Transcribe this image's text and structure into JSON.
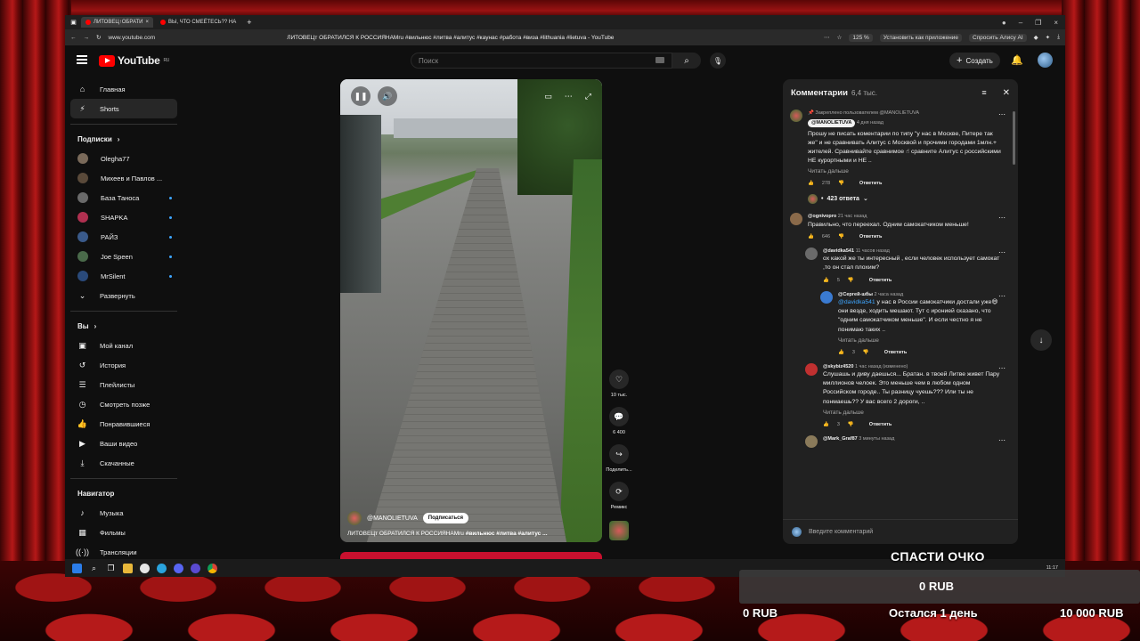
{
  "browser": {
    "tabs": [
      {
        "label": "ЛИТОВЕЦ↑ОБРАТИ",
        "active": true
      },
      {
        "label": "ВЫ, ЧТО СМЕЁТЕСЬ?? НА",
        "active": false
      }
    ],
    "url": "www.youtube.com",
    "page_title": "ЛИТОВЕЦт ОБРАТИЛСЯ К РОССИЯНАМru #вильнюс #литва #алитус #каунас #работа #виза #lithuania #lietuva - YouTube",
    "zoom": "125 %",
    "install_app": "Установить как приложение",
    "ask_alice": "Спросить Алису AI"
  },
  "header": {
    "logo_text": "YouTube",
    "logo_region": "RU",
    "search_placeholder": "Поиск",
    "create_label": "Создать"
  },
  "sidebar": {
    "main": [
      {
        "label": "Главная",
        "icon": "home-icon"
      },
      {
        "label": "Shorts",
        "icon": "shorts-icon",
        "active": true
      }
    ],
    "subscriptions_title": "Подписки",
    "subscriptions": [
      {
        "label": "Olegha77",
        "color": "#7a6a5a",
        "live": false
      },
      {
        "label": "Михеев и Павлов ...",
        "color": "#5a4a3a",
        "live": false
      },
      {
        "label": "База Таноса",
        "color": "#6a6a6a",
        "live": true
      },
      {
        "label": "SHAPKA",
        "color": "#b03050",
        "live": true
      },
      {
        "label": "РАЙЗ",
        "color": "#3a5a8a",
        "live": true
      },
      {
        "label": "Joe Speen",
        "color": "#4a6a4a",
        "live": true
      },
      {
        "label": "MrSilent",
        "color": "#2a4a7a",
        "live": true
      }
    ],
    "expand_label": "Развернуть",
    "you_title": "Вы",
    "you_items": [
      {
        "label": "Мой канал",
        "icon": "channel-icon"
      },
      {
        "label": "История",
        "icon": "history-icon"
      },
      {
        "label": "Плейлисты",
        "icon": "playlist-icon"
      },
      {
        "label": "Смотреть позже",
        "icon": "watch-later-icon"
      },
      {
        "label": "Понравившиеся",
        "icon": "like-icon"
      },
      {
        "label": "Ваши видео",
        "icon": "video-icon"
      },
      {
        "label": "Скачанные",
        "icon": "download-icon"
      }
    ],
    "nav_title": "Навигатор",
    "nav_items": [
      {
        "label": "Музыка",
        "icon": "music-icon"
      },
      {
        "label": "Фильмы",
        "icon": "film-icon"
      },
      {
        "label": "Трансляции",
        "icon": "live-icon"
      }
    ]
  },
  "video": {
    "channel": "@MANOLIETUVA",
    "subscribe_label": "Подписаться",
    "title_prefix": "ЛИТОВЕЦт ОБРАТИЛСЯ К РОССИЯНАМru",
    "title_tags": "#вильнюс #литва #алитус ..."
  },
  "actions": {
    "likes": "10 тыс.",
    "comments": "6 400",
    "share": "Поделить...",
    "remix": "Ремикс"
  },
  "comments": {
    "title": "Комментарии",
    "count": "6,4 тыс.",
    "pinned_by": "Закреплено пользователем @MANOLIETUVA",
    "read_more": "Читать дальше",
    "reply_label": "Ответить",
    "items": [
      {
        "author": "@MANOLIETUVA",
        "time": "4 дня назад",
        "text": "Прошу не писать коментарии по типу \"у нас в Москве, Питере так же\" и не сравнивать Алитус с Москвой и прочими городами 1млн.+ жителей. Сравнивайте сравнимое ☝ сравните Алитус с российскими НЕ курортными и НЕ ..",
        "likes": "278",
        "avatar_color": "#c04040"
      },
      {
        "author": "@ognivopro",
        "time": "21 час назад",
        "text": "Правильно, что переехал. Одним самокатчиком меньше!",
        "likes": "646",
        "avatar_color": "#8a6a4a"
      },
      {
        "author": "@davidka541",
        "time": "11 часов назад",
        "text": "ох какой же ты интересный , если человек использует самокат ,то он стал плохим?",
        "likes": "5",
        "avatar_color": "#6a6a6a"
      },
      {
        "author": "@Сергей-шбы",
        "time": "2 часа назад",
        "mention": "@davidka541",
        "text": " у нас в России самокатчики достали уже😄 они везде, ходить мешают. Тут с иронией сказано, что \"одним самокатчиком меньше\". И если честно я не понимаю таких ..",
        "likes": "3",
        "avatar_color": "#3a7ad0"
      },
      {
        "author": "@skybiz4520",
        "time": "1 час назад (изменено)",
        "text": "Слушашь и диву даешься... Братан. в твоей Литве живет Пару миллионов челоек. Это меньше чем в любом одном Российском городе.. Ты разницу чуешь??? Или ты не понмаешь?? У вас всего 2 дороги, ..",
        "likes": "3",
        "avatar_color": "#c03030"
      },
      {
        "author": "@Mark_Graf87",
        "time": "3 минуты назад",
        "avatar_color": "#8a7a5a"
      }
    ],
    "replies_label": "423 ответа",
    "input_placeholder": "Введите комментарий"
  },
  "taskbar": {
    "clock": "11:17"
  },
  "donation": {
    "title": "СПАСТИ ОЧКО",
    "amount": "0 RUB",
    "min": "0 RUB",
    "left": "Остался 1 день",
    "max": "10 000 RUB"
  }
}
